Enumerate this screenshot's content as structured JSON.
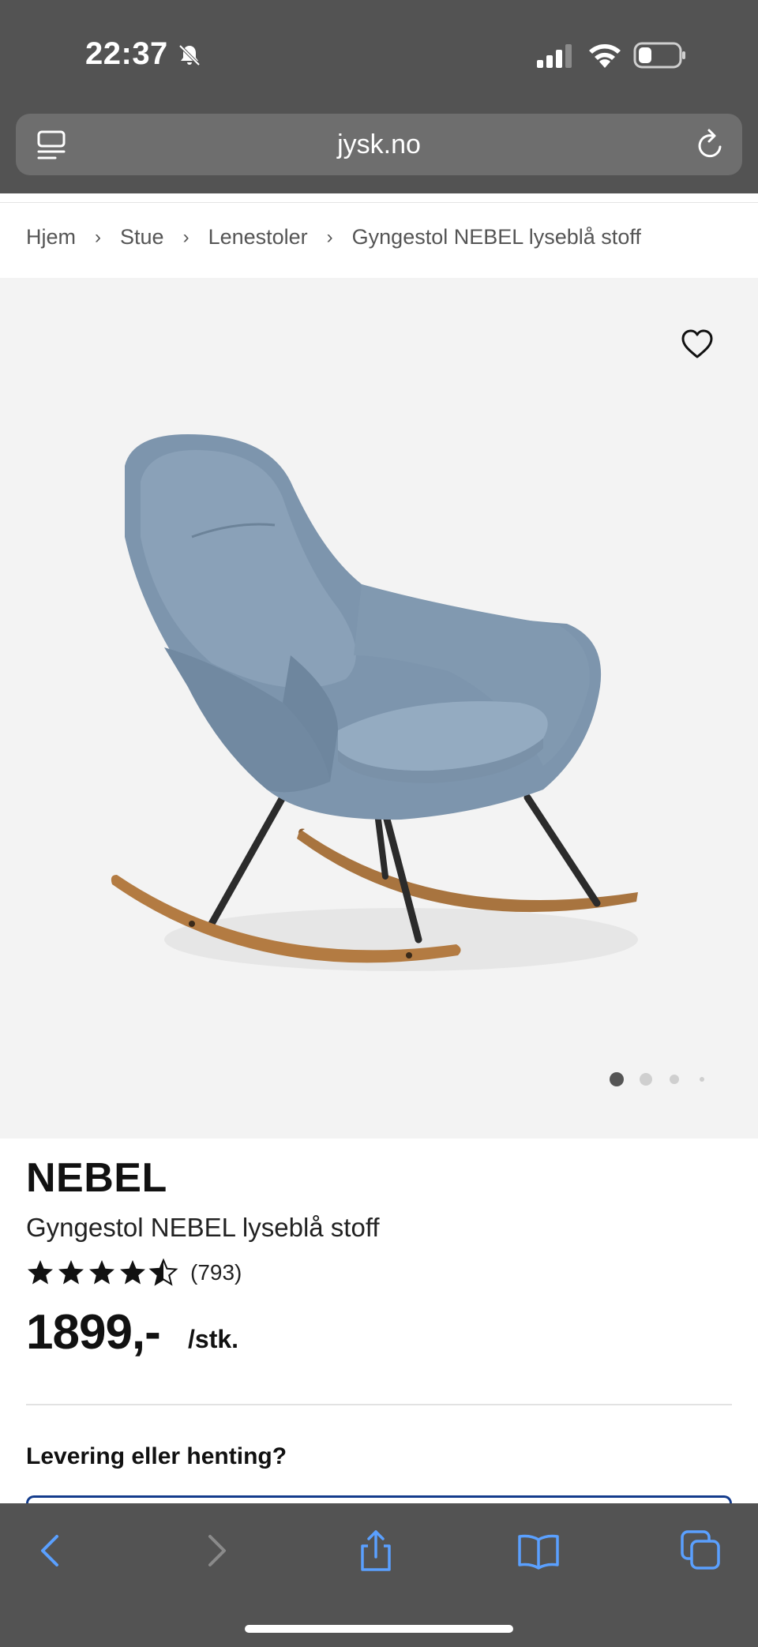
{
  "status_bar": {
    "time": "22:37",
    "icons": [
      "bell-slash-icon",
      "signal-icon",
      "wifi-icon",
      "battery-icon"
    ]
  },
  "browser": {
    "url": "jysk.no",
    "icons": [
      "tab-overview-icon",
      "reload-icon"
    ]
  },
  "breadcrumb": {
    "items": [
      "Hjem",
      "Stue",
      "Lenestoler",
      "Gyngestol NEBEL lyseblå stoff"
    ],
    "separator": "›"
  },
  "gallery": {
    "image_alt": "Gyngestol NEBEL lyseblå stoff",
    "image_count": 4,
    "active_index": 0
  },
  "product": {
    "brand": "NEBEL",
    "name": "Gyngestol NEBEL lyseblå stoff",
    "rating": 4.5,
    "rating_max": 5,
    "review_count": "(793)",
    "price": "1899,-",
    "unit": "/stk."
  },
  "delivery": {
    "title": "Levering eller henting?"
  },
  "toolbar": {
    "buttons": [
      "back-icon",
      "forward-icon",
      "share-icon",
      "bookmarks-icon",
      "tabs-icon"
    ]
  },
  "colors": {
    "chrome": "#535353",
    "urlbar": "#6e6e6e",
    "hero_bg": "#f3f3f3",
    "accent_blue": "#143c8c",
    "toolbar_active": "#5aa0ff",
    "chair_fabric": "#7d95ad",
    "chair_wood": "#a8743f"
  }
}
